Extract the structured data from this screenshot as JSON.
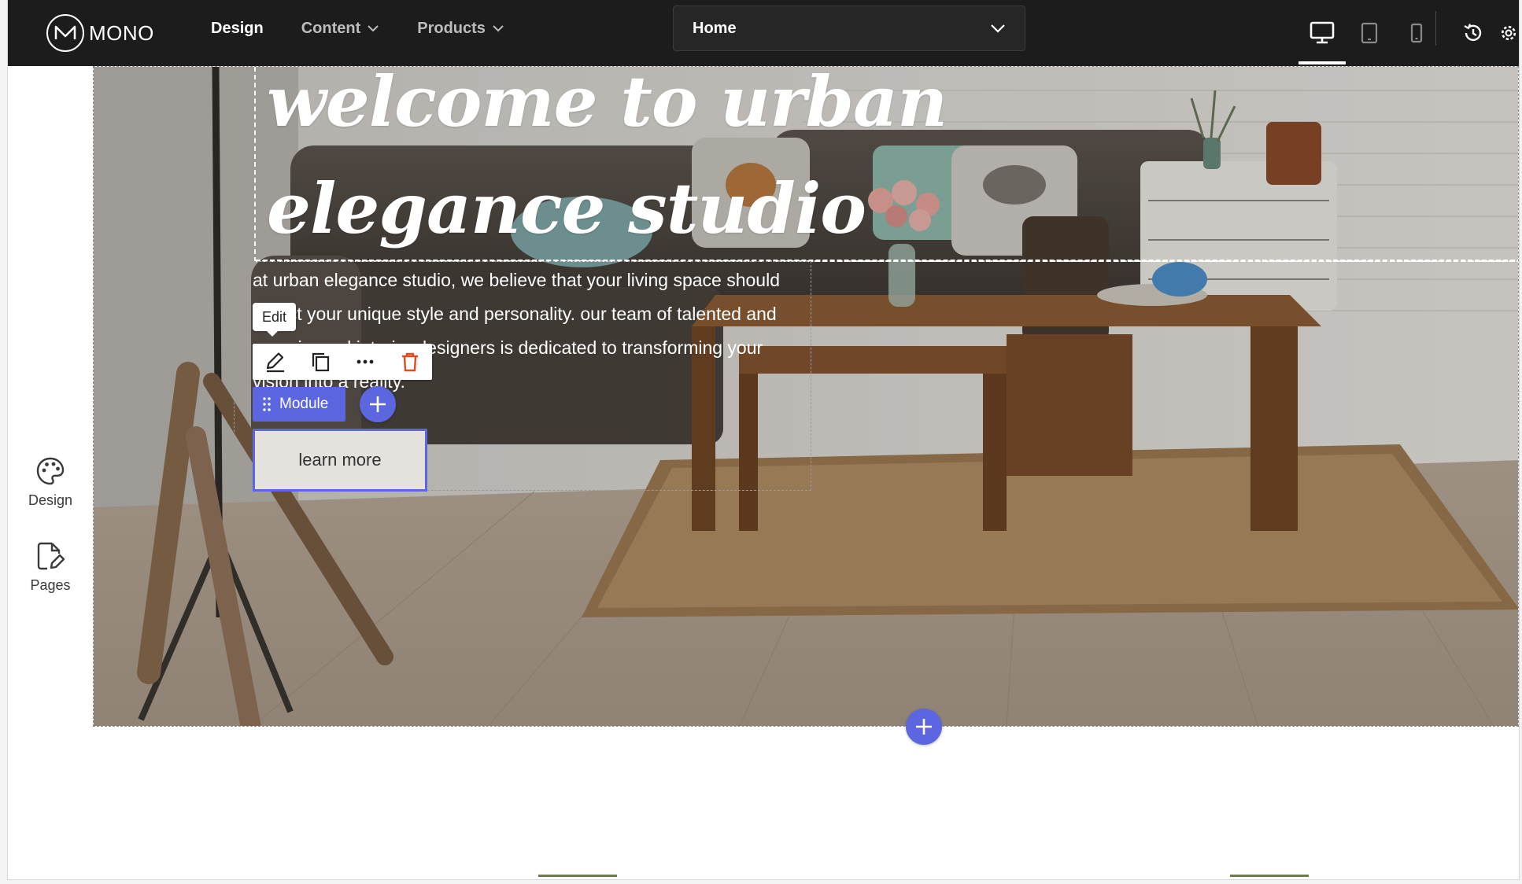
{
  "app": {
    "logo_text": "MONO"
  },
  "nav": {
    "items": [
      {
        "label": "Design",
        "active": true,
        "has_dropdown": false
      },
      {
        "label": "Content",
        "active": false,
        "has_dropdown": true
      },
      {
        "label": "Products",
        "active": false,
        "has_dropdown": true
      }
    ]
  },
  "page_selector": {
    "value": "Home"
  },
  "devices": {
    "selected": "desktop",
    "options": [
      "desktop",
      "tablet",
      "mobile"
    ]
  },
  "rail": {
    "items": [
      {
        "label": "Design",
        "icon": "palette-icon"
      },
      {
        "label": "Pages",
        "icon": "page-edit-icon"
      }
    ]
  },
  "hero": {
    "heading_line1": "welcome to urban",
    "heading_line2": "elegance studio",
    "paragraph": "at urban elegance studio, we believe that your living space should reflect your unique style and personality. our team of talented and experienced interior designers is dedicated to transforming your vision into a reality.",
    "cta_label": "learn more"
  },
  "editor": {
    "tooltip": "Edit",
    "module_label": "Module",
    "tools": [
      "edit-icon",
      "duplicate-icon",
      "more-icon",
      "delete-icon"
    ]
  },
  "colors": {
    "topbar": "#1c1c1c",
    "accent": "#5b66e0",
    "delete": "#e04a1f",
    "button_bg": "#e5e2dd"
  }
}
